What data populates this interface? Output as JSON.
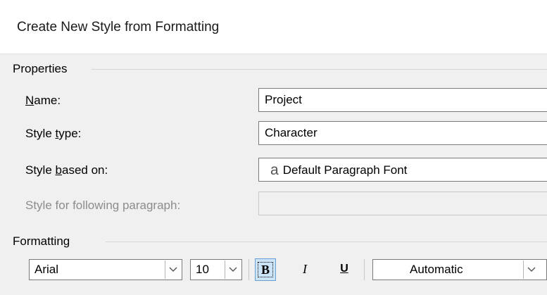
{
  "dialog": {
    "title": "Create New Style from Formatting"
  },
  "properties": {
    "heading": "Properties",
    "name_label_pre": "",
    "name_label_u": "N",
    "name_label_post": "ame:",
    "name_value": "Project",
    "style_type_label_pre": "Style ",
    "style_type_label_u": "t",
    "style_type_label_post": "ype:",
    "style_type_value": "Character",
    "based_on_label_pre": "Style ",
    "based_on_label_u": "b",
    "based_on_label_post": "ased on:",
    "based_on_icon": "a",
    "based_on_value": "Default Paragraph Font",
    "following_label": "Style for following paragraph:",
    "following_value": ""
  },
  "formatting": {
    "heading": "Formatting",
    "font": "Arial",
    "size": "10",
    "bold_label": "B",
    "italic_label": "I",
    "underline_label": "U",
    "color": "Automatic"
  }
}
